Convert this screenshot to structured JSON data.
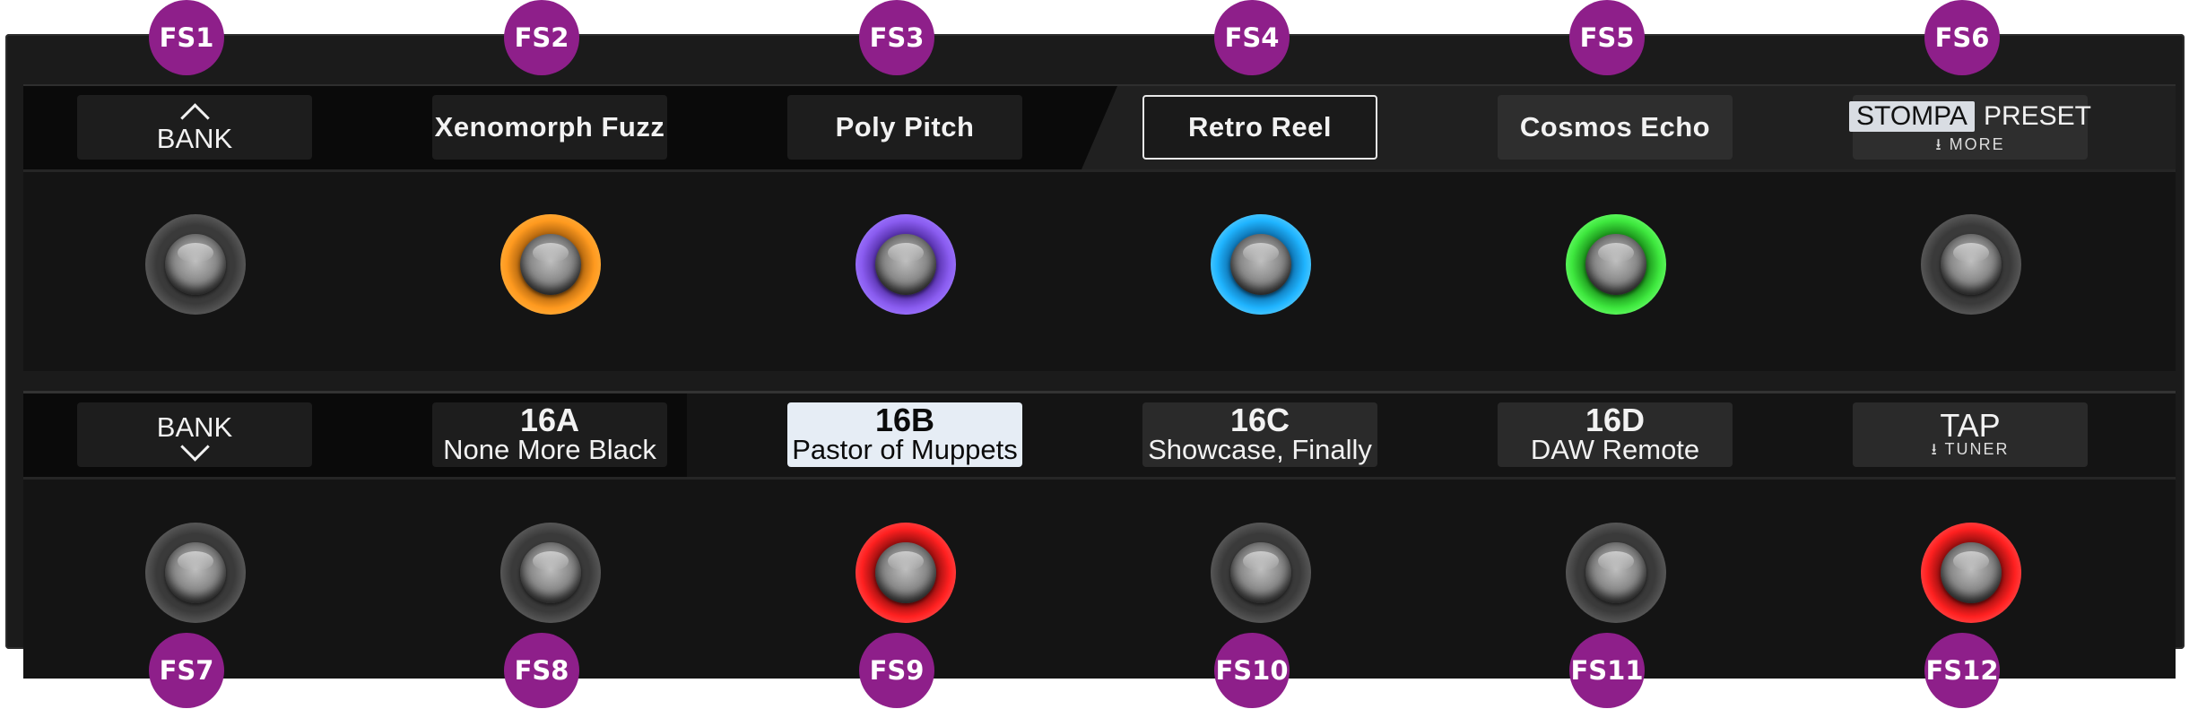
{
  "top_row": [
    {
      "id": "FS1",
      "label": "BANK",
      "kind": "bank-up",
      "led": "#6a6a6a"
    },
    {
      "id": "FS2",
      "label": "Xenomorph Fuzz",
      "kind": "text",
      "led": "#ff9a1f"
    },
    {
      "id": "FS3",
      "label": "Poly Pitch",
      "kind": "text",
      "led": "#8a5cf0"
    },
    {
      "id": "FS4",
      "label": "Retro Reel",
      "kind": "outlined",
      "led": "#1fb4ff"
    },
    {
      "id": "FS5",
      "label": "Cosmos Echo",
      "kind": "text",
      "led": "#3ee83e"
    },
    {
      "id": "FS6",
      "label_a": "STOMPA",
      "label_b": "PRESET",
      "sub": "MORE",
      "kind": "stompa",
      "led": "#6a6a6a"
    }
  ],
  "bottom_row": [
    {
      "id": "FS7",
      "label": "BANK",
      "kind": "bank-down",
      "led": "#6a6a6a"
    },
    {
      "id": "FS8",
      "title": "16A",
      "sub": "None More Black",
      "kind": "preset",
      "led": "#6a6a6a"
    },
    {
      "id": "FS9",
      "title": "16B",
      "sub": "Pastor of Muppets",
      "kind": "preset-selected",
      "led": "#ff2020"
    },
    {
      "id": "FS10",
      "title": "16C",
      "sub": "Showcase, Finally",
      "kind": "preset",
      "led": "#6a6a6a"
    },
    {
      "id": "FS11",
      "title": "16D",
      "sub": "DAW Remote",
      "kind": "preset",
      "led": "#6a6a6a"
    },
    {
      "id": "FS12",
      "label": "TAP",
      "sub": "TUNER",
      "kind": "tap",
      "led": "#ff2020"
    }
  ],
  "colors": {
    "badge": "#8e1f8a",
    "device": "#1b1b1b",
    "label_bg": "#1d1d1d"
  }
}
